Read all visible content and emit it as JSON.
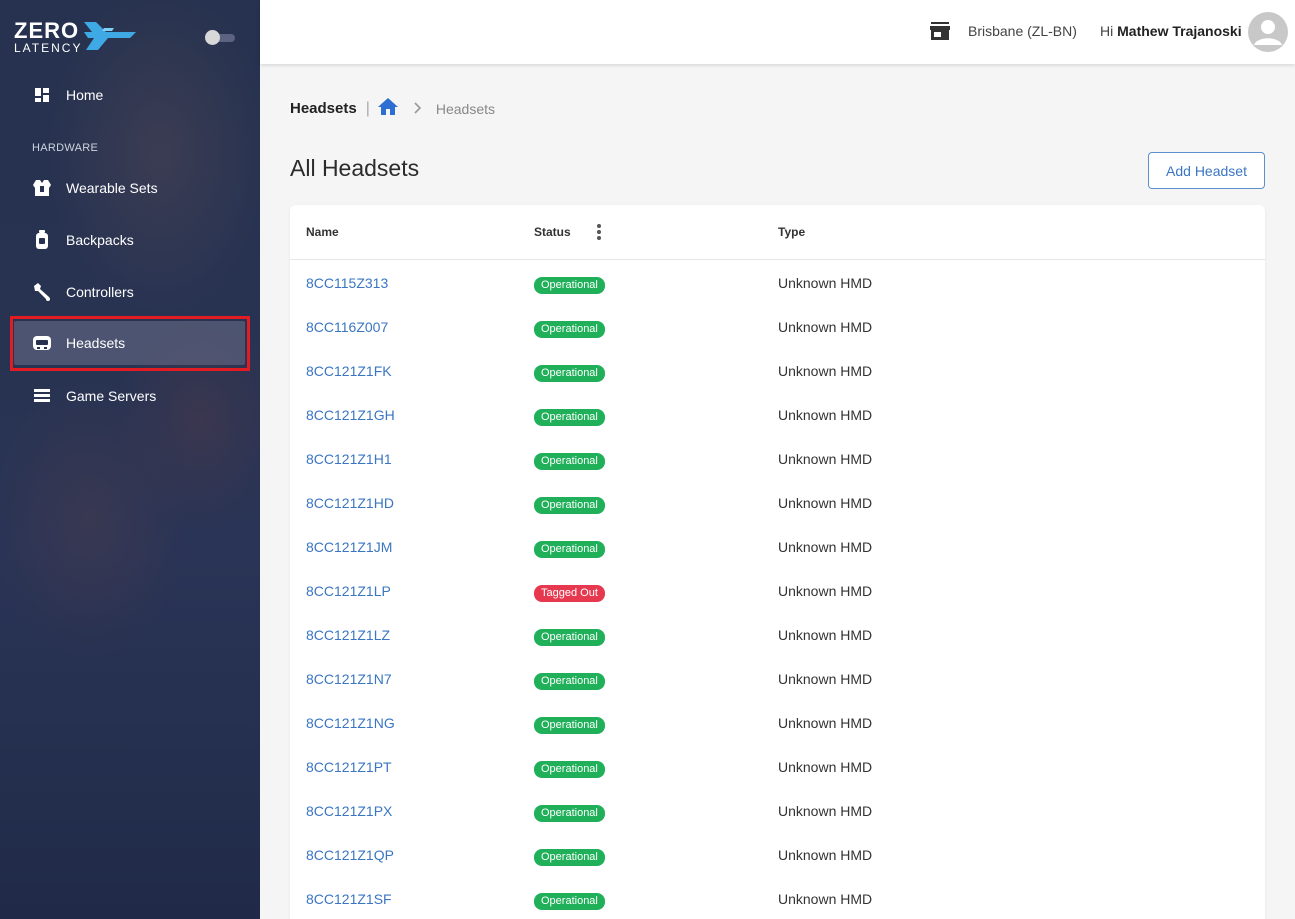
{
  "brand": {
    "name": "ZERO",
    "sub": "LATENCY"
  },
  "sidebar": {
    "home_label": "Home",
    "section_label": "HARDWARE",
    "items": [
      {
        "label": "Wearable Sets",
        "icon": "vest-icon"
      },
      {
        "label": "Backpacks",
        "icon": "backpack-icon"
      },
      {
        "label": "Controllers",
        "icon": "controller-icon"
      },
      {
        "label": "Headsets",
        "icon": "headset-icon",
        "active": true
      },
      {
        "label": "Game Servers",
        "icon": "server-icon"
      }
    ]
  },
  "topbar": {
    "location": "Brisbane (ZL-BN)",
    "greeting_prefix": "Hi",
    "user_name": "Mathew Trajanoski"
  },
  "breadcrumb": {
    "title": "Headsets",
    "current": "Headsets"
  },
  "page": {
    "title": "All Headsets",
    "add_button": "Add Headset"
  },
  "table": {
    "columns": {
      "name": "Name",
      "status": "Status",
      "type": "Type"
    },
    "rows": [
      {
        "name": "8CC115Z313",
        "status": "Operational",
        "type": "Unknown HMD"
      },
      {
        "name": "8CC116Z007",
        "status": "Operational",
        "type": "Unknown HMD"
      },
      {
        "name": "8CC121Z1FK",
        "status": "Operational",
        "type": "Unknown HMD"
      },
      {
        "name": "8CC121Z1GH",
        "status": "Operational",
        "type": "Unknown HMD"
      },
      {
        "name": "8CC121Z1H1",
        "status": "Operational",
        "type": "Unknown HMD"
      },
      {
        "name": "8CC121Z1HD",
        "status": "Operational",
        "type": "Unknown HMD"
      },
      {
        "name": "8CC121Z1JM",
        "status": "Operational",
        "type": "Unknown HMD"
      },
      {
        "name": "8CC121Z1LP",
        "status": "Tagged Out",
        "type": "Unknown HMD"
      },
      {
        "name": "8CC121Z1LZ",
        "status": "Operational",
        "type": "Unknown HMD"
      },
      {
        "name": "8CC121Z1N7",
        "status": "Operational",
        "type": "Unknown HMD"
      },
      {
        "name": "8CC121Z1NG",
        "status": "Operational",
        "type": "Unknown HMD"
      },
      {
        "name": "8CC121Z1PT",
        "status": "Operational",
        "type": "Unknown HMD"
      },
      {
        "name": "8CC121Z1PX",
        "status": "Operational",
        "type": "Unknown HMD"
      },
      {
        "name": "8CC121Z1QP",
        "status": "Operational",
        "type": "Unknown HMD"
      },
      {
        "name": "8CC121Z1SF",
        "status": "Operational",
        "type": "Unknown HMD"
      }
    ]
  },
  "colors": {
    "accent": "#3a76c2",
    "status_ok": "#21b05a",
    "status_out": "#e63950",
    "highlight": "#e31b23"
  }
}
